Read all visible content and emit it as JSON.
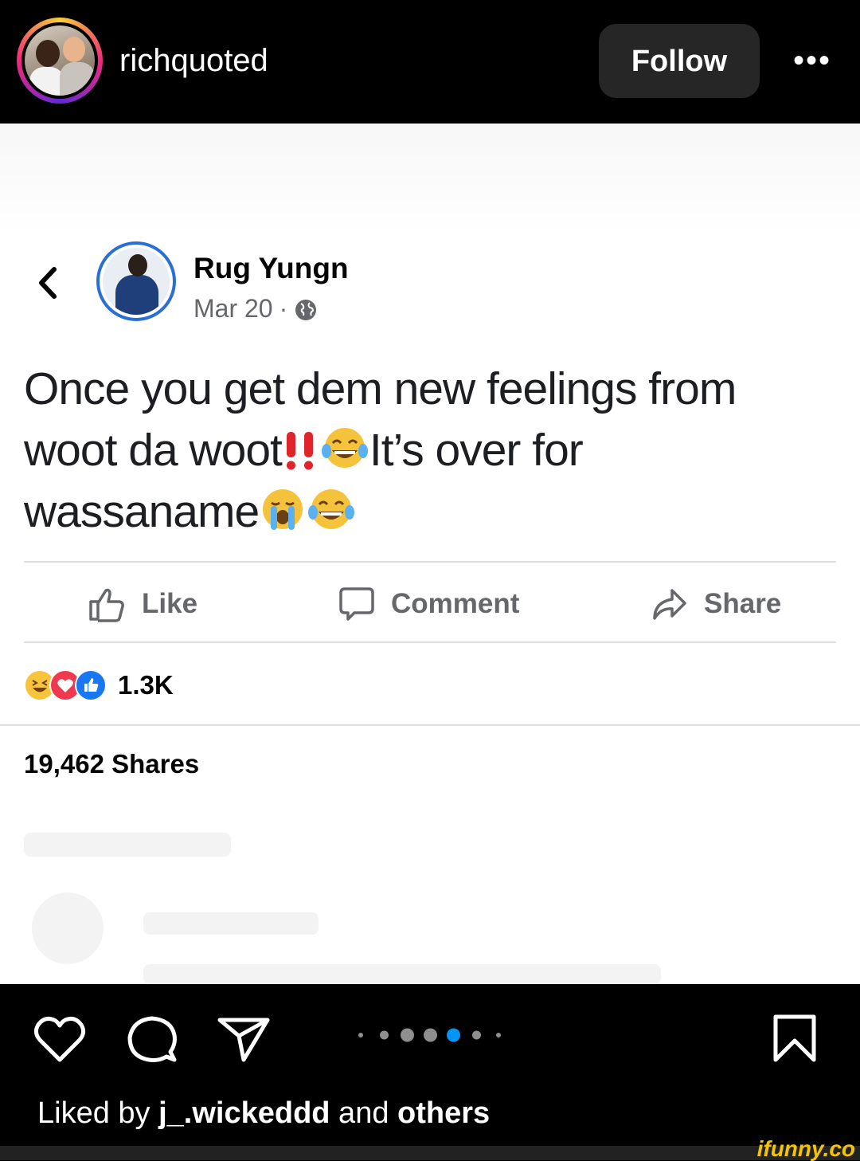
{
  "instagram": {
    "username": "richquoted",
    "follow_label": "Follow",
    "more_icon": "more-dots-icon",
    "more_label": "•••",
    "liked_prefix": "Liked by ",
    "liked_user": "j_.wickeddd",
    "liked_middle": " and ",
    "liked_others": "others",
    "carousel": {
      "count": 7,
      "active_index": 4
    },
    "icons": [
      "heart-icon",
      "comment-icon",
      "share-icon",
      "bookmark-icon"
    ]
  },
  "post": {
    "author_name": "Rug Yungn",
    "date": "Mar 20",
    "separator": "·",
    "privacy_icon": "globe-icon",
    "text_line1": "Once you get dem new feelings from",
    "text_line2a": "woot da woot",
    "text_line2b": "It’s over for",
    "text_line3": "wassaname",
    "actions": {
      "like": "Like",
      "comment": "Comment",
      "share": "Share"
    },
    "reaction_count": "1.3K",
    "shares": "19,462 Shares"
  },
  "watermark": "ifunny.co",
  "colors": {
    "fb_blue": "#1877f2",
    "ig_follow_bg": "#262626",
    "carousel_active": "#0095f6"
  }
}
